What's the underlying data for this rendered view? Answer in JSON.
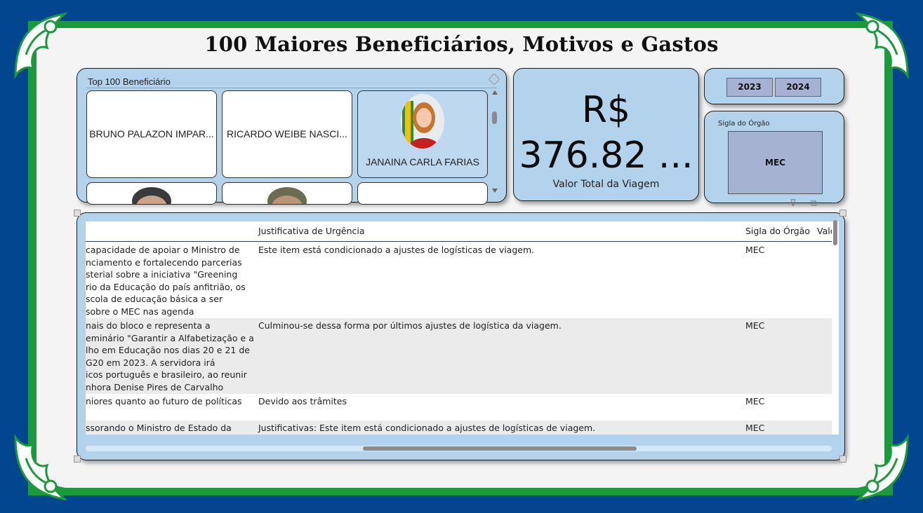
{
  "page": {
    "title": "100 Maiores Beneficiários, Motivos e Gastos"
  },
  "beneficiarios": {
    "title": "Top 100 Beneficiário",
    "cards": [
      {
        "name": "BRUNO PALAZON IMPAR..."
      },
      {
        "name": "RICARDO WEIBE NASCI..."
      },
      {
        "name": "JANAINA CARLA FARIAS",
        "selected": true
      }
    ]
  },
  "kpi": {
    "value_line1": "R$",
    "value_line2": "376.82 ...",
    "label": "Valor Total da Viagem"
  },
  "years": [
    "2023",
    "2024"
  ],
  "orgao": {
    "title": "Sigla do Órgão",
    "value": "MEC"
  },
  "table": {
    "headers": [
      "Justificativa de Urgência",
      "Sigla do Órgão",
      "Valo"
    ],
    "rows": [
      {
        "motivo": [
          "capacidade de apoiar o Ministro de",
          "nciamento e fortalecendo parcerias",
          "sterial sobre a iniciativa \"Greening",
          "rio da Educação do país anfitrião, os",
          "scola de educação básica a ser",
          "sobre o MEC nas agenda"
        ],
        "justificativa": "Este item está condicionado a ajustes de logísticas de viagem.",
        "sigla": "MEC"
      },
      {
        "motivo": [
          "nais do bloco e representa a",
          "eminário \"Garantir a Alfabetização e a",
          "lho em Educação nos dias 20 e 21 de",
          "G20 em 2023. A servidora irá",
          "icos português e brasileiro, ao reunir",
          "nhora Denise Pires de Carvalho"
        ],
        "justificativa": "Culminou-se dessa forma por últimos ajustes de logística da viagem.",
        "sigla": "MEC"
      },
      {
        "motivo": [
          "niores quanto ao futuro de políticas"
        ],
        "justificativa": "Devido aos trâmites",
        "sigla": "MEC"
      },
      {
        "motivo": [
          "ssorando o Ministro de Estado da"
        ],
        "justificativa": "Justificativas: Este item está condicionado a ajustes de logísticas de viagem.",
        "sigla": "MEC"
      }
    ]
  },
  "colors": {
    "background": "#02468f",
    "frame": "#1a9a3c",
    "panel": "#b3d2ec",
    "slicer": "#a6b2d2"
  }
}
